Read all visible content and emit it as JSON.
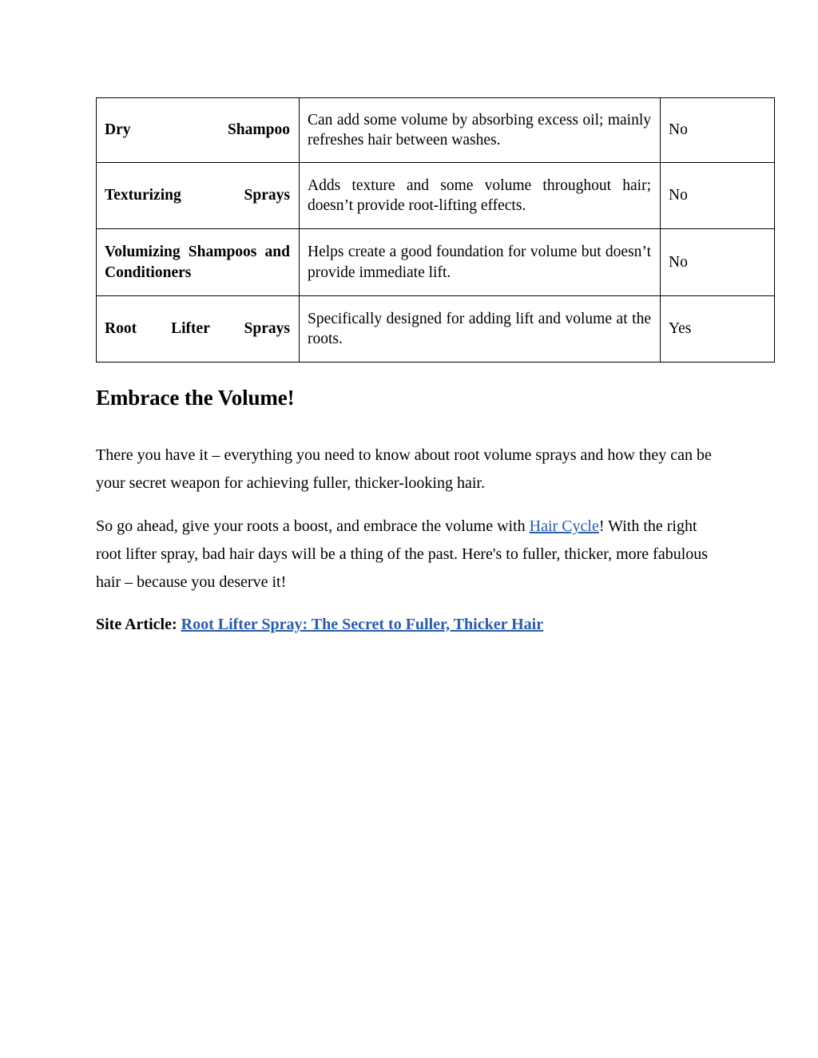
{
  "document": {
    "table": {
      "rows": [
        {
          "type": "Dry Shampoo",
          "description": "Can add some volume by absorbing excess oil; mainly refreshes hair between washes.",
          "lift": "No"
        },
        {
          "type": "Texturizing Sprays",
          "description": "Adds texture and some volume throughout hair; doesn’t provide root-lifting effects.",
          "lift": "No"
        },
        {
          "type": "Volumizing Shampoos and Conditioners",
          "description": "Helps create a good foundation for volume but doesn’t provide immediate lift.",
          "lift": "No"
        },
        {
          "type": "Root Lifter Sprays",
          "description": "Specifically designed for adding lift and volume at the roots.",
          "lift": "Yes"
        }
      ]
    },
    "heading": "Embrace the Volume!",
    "paragraph_1": "There you have it – everything you need to know about root volume sprays and how they can be your secret weapon for achieving fuller, thicker-looking hair.",
    "paragraph_2": {
      "before_link": "So go ahead, give your roots a boost, and embrace the volume with ",
      "link_text": "Hair Cycle",
      "after_link": "! With the right root lifter spray, bad hair days will be a thing of the past. Here's to fuller, thicker, more fabulous hair – because you deserve it!"
    },
    "site_article": {
      "label": "Site Article:",
      "link_text": "Root Lifter Spray: The Secret to Fuller, Thicker Hair"
    },
    "colors": {
      "link": "#2a5caa",
      "text": "#000000",
      "background": "#ffffff",
      "table_border": "#000000"
    }
  }
}
